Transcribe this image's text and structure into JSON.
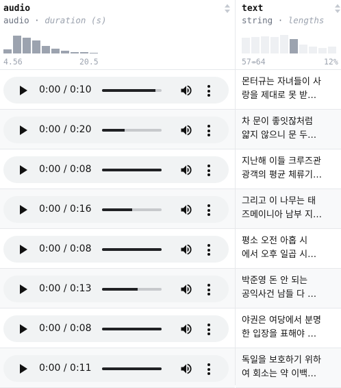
{
  "columns": {
    "audio": {
      "name": "audio",
      "type": "audio",
      "stat": "duration (s)",
      "min_label": "4.56",
      "max_label": "20.5",
      "histogram": [
        0.17,
        0.68,
        0.6,
        0.5,
        0.28,
        0.18,
        0.11,
        0.06,
        0.04,
        0.02
      ]
    },
    "text": {
      "name": "text",
      "type": "string",
      "stat": "lengths",
      "range_label": "57⇸64",
      "pct_label": "12%",
      "histogram": [
        0.6,
        0.62,
        0.66,
        0.64,
        0.72,
        0.55,
        0.35,
        0.25,
        0.22,
        0.25
      ],
      "highlight_index": 5
    }
  },
  "separator": "·",
  "rows": [
    {
      "time": "0:00 / 0:10",
      "progress": 0.9,
      "text": [
        "몬터규는 자녀들이 사",
        "랑을 제대로 못 받…"
      ]
    },
    {
      "time": "0:00 / 0:20",
      "progress": 0.38,
      "text": [
        "차 문이 좋잇잖처럼",
        "얇지 않으니 문 두…"
      ]
    },
    {
      "time": "0:00 / 0:08",
      "progress": 1.0,
      "text": [
        "지난해 이들 크루즈관",
        "광객의 평균 체류기…"
      ]
    },
    {
      "time": "0:00 / 0:16",
      "progress": 0.5,
      "text": [
        "그리고 이 나무는 태",
        "즈메이니아 남부 지…"
      ]
    },
    {
      "time": "0:00 / 0:08",
      "progress": 1.0,
      "text": [
        "평소 오전 아홉 시",
        "에서 오후 일곱 시…"
      ]
    },
    {
      "time": "0:00 / 0:13",
      "progress": 0.6,
      "text": [
        "박준영 돈 안 되는",
        "공익사건 남들 다 …"
      ]
    },
    {
      "time": "0:00 / 0:08",
      "progress": 1.0,
      "text": [
        "야권은 여당에서 분명",
        "한 입장을 표해야 …"
      ]
    },
    {
      "time": "0:00 / 0:11",
      "progress": 1.0,
      "text": [
        "독일을 보호하기 위하",
        "여 회소는 약 이백…"
      ]
    }
  ],
  "icons": {
    "play": "play-icon",
    "volume": "volume-icon",
    "menu": "more-vertical-icon",
    "sort": "sort-icon"
  }
}
